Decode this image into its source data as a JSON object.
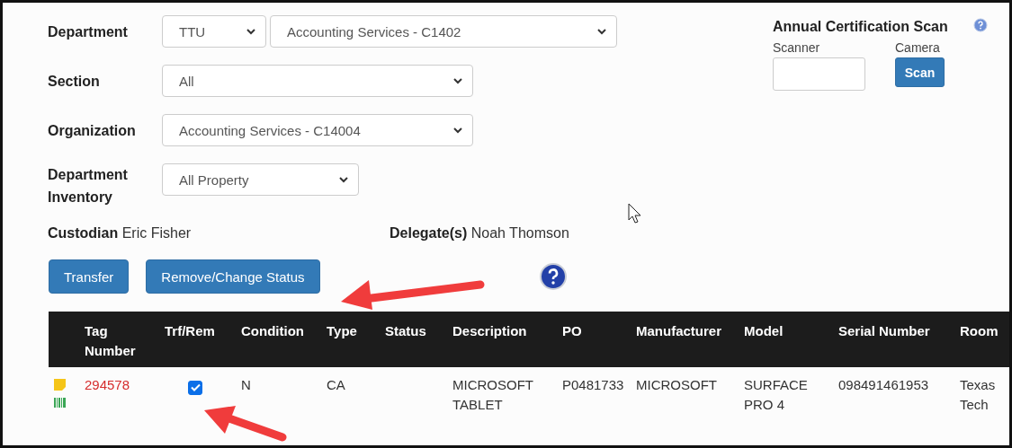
{
  "filters": [
    {
      "label": "Department",
      "selects": [
        {
          "value": "TTU"
        },
        {
          "value": "Accounting Services - C1402"
        }
      ]
    },
    {
      "label": "Section",
      "selects": [
        {
          "value": "All"
        }
      ]
    },
    {
      "label": "Organization",
      "selects": [
        {
          "value": "Accounting Services - C14004"
        }
      ]
    },
    {
      "label": "Department Inventory",
      "selects": [
        {
          "value": "All Property"
        }
      ]
    }
  ],
  "custodian": {
    "label": "Custodian",
    "value": "Eric Fisher"
  },
  "delegate": {
    "label": "Delegate(s)",
    "value": "Noah Thomson"
  },
  "certification": {
    "title": "Annual Certification Scan",
    "scanner_label": "Scanner",
    "camera_label": "Camera",
    "scan_button": "Scan"
  },
  "buttons": [
    "Transfer",
    "Remove/Change Status"
  ],
  "table": {
    "columns": [
      "Tag Number",
      "Trf/Rem",
      "Condition",
      "Type",
      "Status",
      "Description",
      "PO",
      "Manufacturer",
      "Model",
      "Serial Number",
      "Room"
    ],
    "rows": [
      {
        "tag_number": "294578",
        "trf_rem": true,
        "condition": "N",
        "type": "CA",
        "description": "MICROSOFT TABLET",
        "po": "P0481733",
        "manufacturer": "MICROSOFT",
        "model": "SURFACE PRO 4",
        "serial_number": "098491461953",
        "room": "Texas Tech"
      }
    ]
  }
}
